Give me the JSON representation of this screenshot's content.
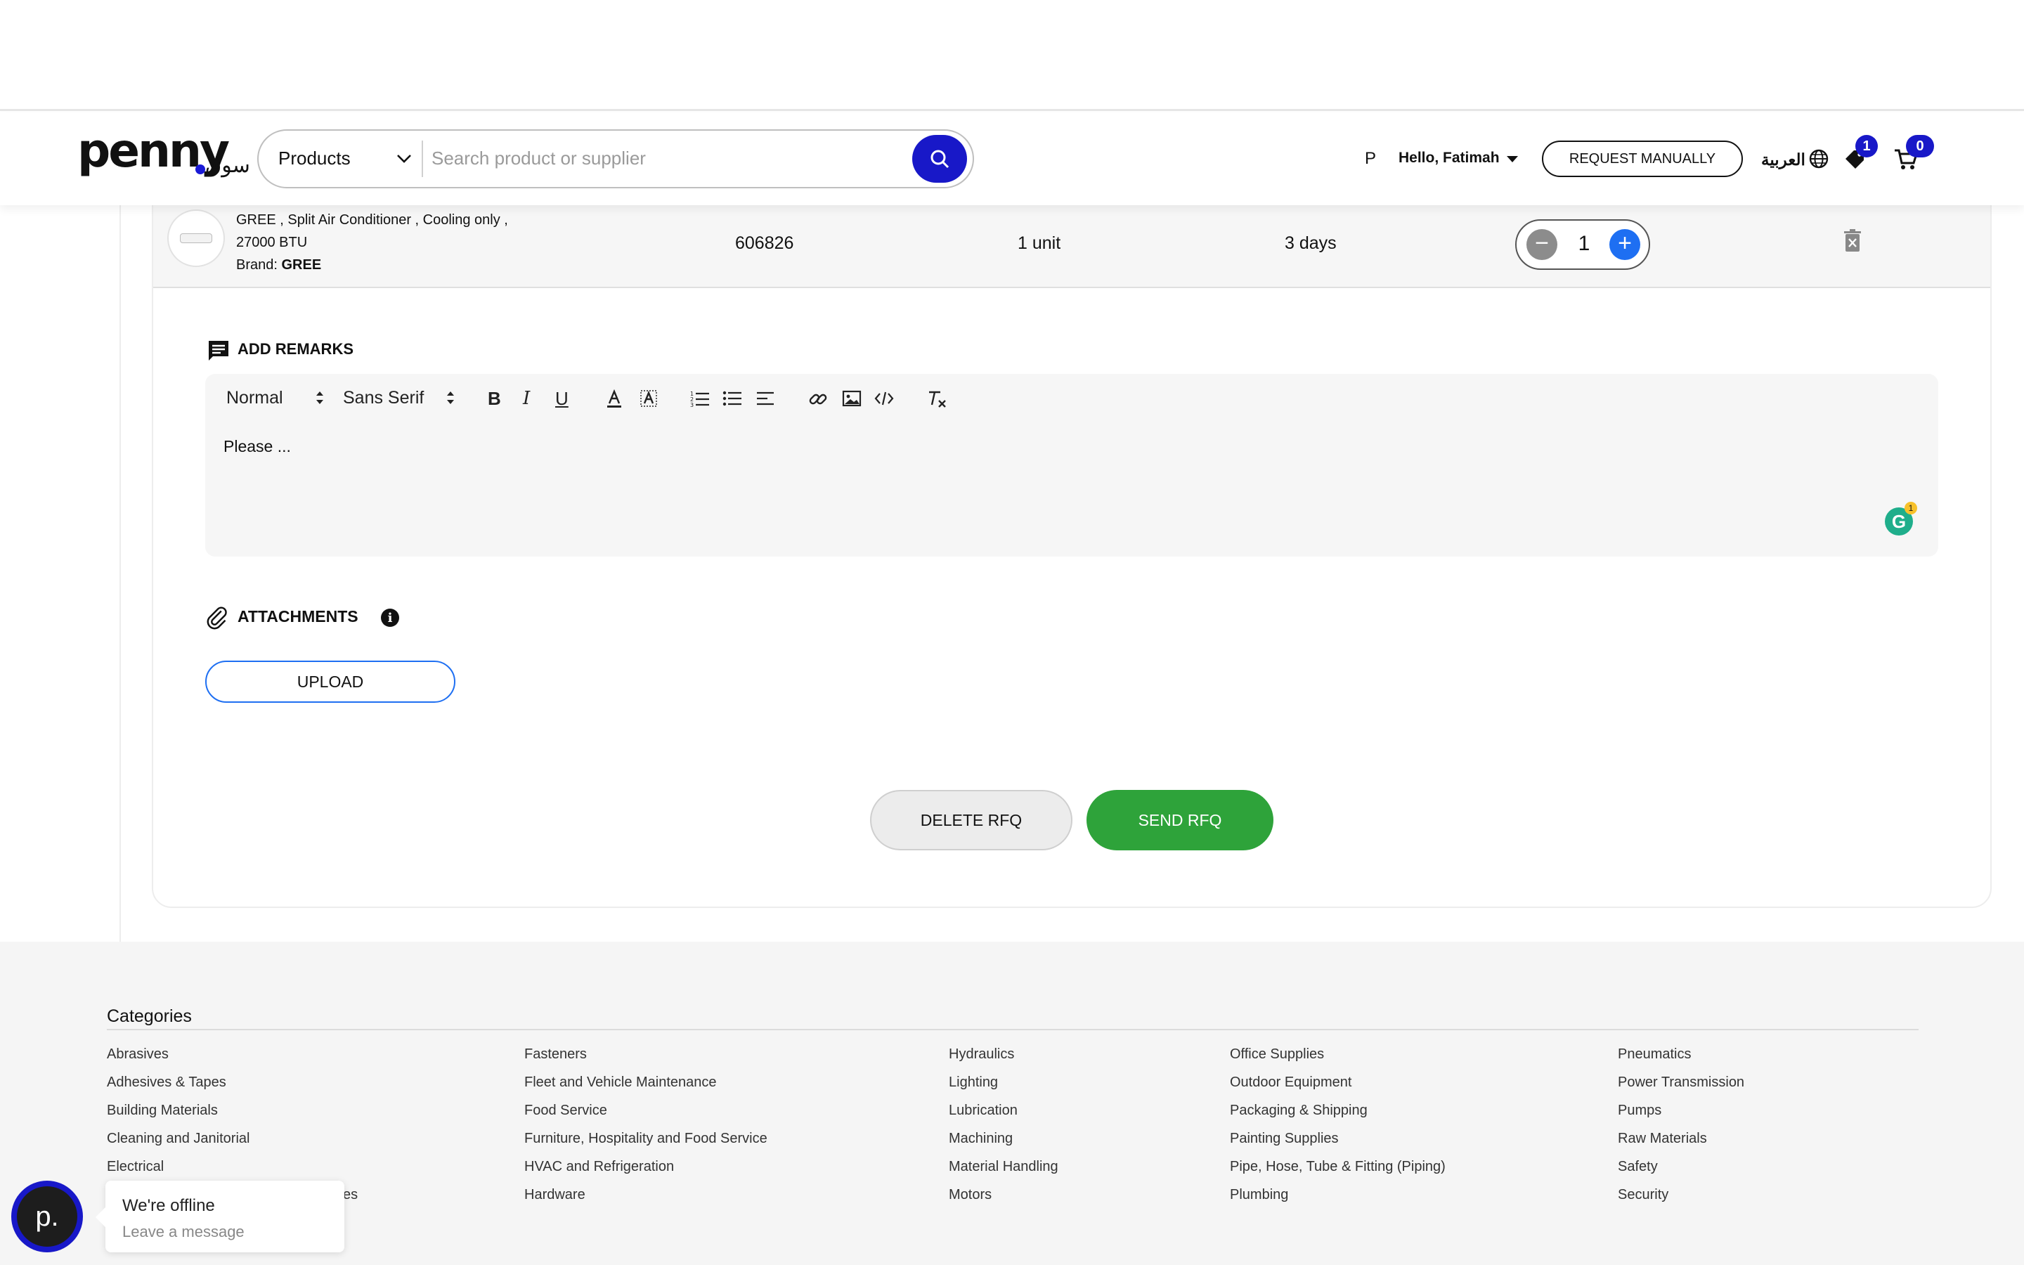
{
  "header": {
    "logo_text": "penny",
    "logo_arabic": "سوق",
    "search": {
      "category": "Products",
      "placeholder": "Search product or supplier"
    },
    "user_initial": "P",
    "greeting": "Hello, Fatimah",
    "request_button": "REQUEST MANUALLY",
    "language": "العربية",
    "wishlist_count": "1",
    "cart_count": "0"
  },
  "product": {
    "name_line1": "GREE , Split Air Conditioner , Cooling only ,",
    "name_line2": "27000 BTU",
    "brand_label": "Brand:",
    "brand": "GREE",
    "code": "606826",
    "unit": "1 unit",
    "lead_time": "3 days",
    "quantity": "1"
  },
  "remarks": {
    "title": "ADD REMARKS",
    "toolbar": {
      "size": "Normal",
      "font": "Sans Serif"
    },
    "text": "Please ...",
    "grammarly_letter": "G",
    "grammarly_count": "1"
  },
  "attachments": {
    "title": "ATTACHMENTS",
    "info": "i",
    "upload_button": "UPLOAD"
  },
  "actions": {
    "delete": "DELETE RFQ",
    "send": "SEND RFQ"
  },
  "footer": {
    "title": "Categories",
    "columns": [
      [
        "Abrasives",
        "Adhesives & Tapes",
        "Building Materials",
        "Cleaning and Janitorial",
        "Electrical",
        "es"
      ],
      [
        "Fasteners",
        "Fleet and Vehicle Maintenance",
        "Food Service",
        "Furniture, Hospitality and Food Service",
        "HVAC and Refrigeration",
        "Hardware"
      ],
      [
        "Hydraulics",
        "Lighting",
        "Lubrication",
        "Machining",
        "Material Handling",
        "Motors"
      ],
      [
        "Office Supplies",
        "Outdoor Equipment",
        "Packaging & Shipping",
        "Painting Supplies",
        "Pipe, Hose, Tube & Fitting (Piping)",
        "Plumbing"
      ],
      [
        "Pneumatics",
        "Power Transmission",
        "Pumps",
        "Raw Materials",
        "Safety",
        "Security"
      ]
    ]
  },
  "chat": {
    "avatar_letter": "p.",
    "status": "We're offline",
    "prompt": "Leave a message"
  },
  "colors": {
    "brand_blue": "#1818c8",
    "accent_blue": "#1e6ff2",
    "send_green": "#2ea33a"
  }
}
